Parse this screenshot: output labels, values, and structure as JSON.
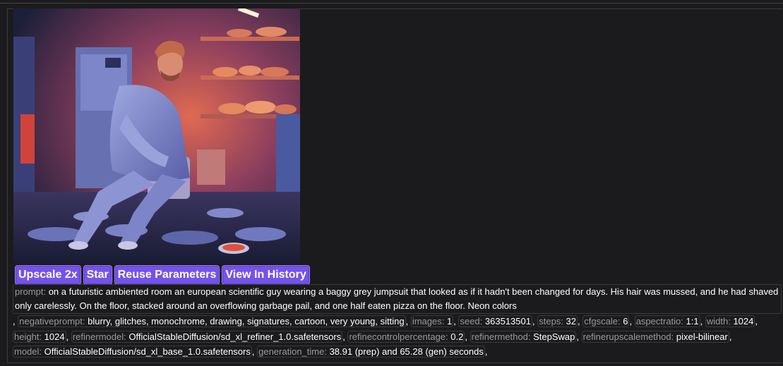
{
  "image": {
    "alt": "Generated image"
  },
  "buttons": {
    "upscale": "Upscale 2x",
    "star": "Star",
    "reuse": "Reuse Parameters",
    "history": "View In History"
  },
  "params": {
    "prompt_key": "prompt:",
    "prompt_val": "on a futuristic ambiented room an european scientific guy wearing a baggy grey jumpsuit that looked as if it hadn't been changed for days. His hair was mussed, and he had shaved only carelessly. On the floor, stacked around an overflowing garbage pail, and one half eaten pizza on the floor. Neon colors",
    "negativeprompt_key": "negativeprompt:",
    "negativeprompt_val": "blurry, glitches, monochrome, drawing, signatures, cartoon, very young, sitting",
    "images_key": "images:",
    "images_val": "1",
    "seed_key": "seed:",
    "seed_val": "363513501",
    "steps_key": "steps:",
    "steps_val": "32",
    "cfgscale_key": "cfgscale:",
    "cfgscale_val": "6",
    "aspectratio_key": "aspectratio:",
    "aspectratio_val": "1:1",
    "width_key": "width:",
    "width_val": "1024",
    "height_key": "height:",
    "height_val": "1024",
    "refinermodel_key": "refinermodel:",
    "refinermodel_val": "OfficialStableDiffusion/sd_xl_refiner_1.0.safetensors",
    "refinecontrolpercentage_key": "refinecontrolpercentage:",
    "refinecontrolpercentage_val": "0.2",
    "refinermethod_key": "refinermethod:",
    "refinermethod_val": "StepSwap",
    "refinerupscalemethod_key": "refinerupscalemethod:",
    "refinerupscalemethod_val": "pixel-bilinear",
    "model_key": "model:",
    "model_val": "OfficialStableDiffusion/sd_xl_base_1.0.safetensors",
    "generation_time_key": "generation_time:",
    "generation_time_val": "38.91 (prep) and 65.28 (gen) seconds",
    "sep": ","
  }
}
